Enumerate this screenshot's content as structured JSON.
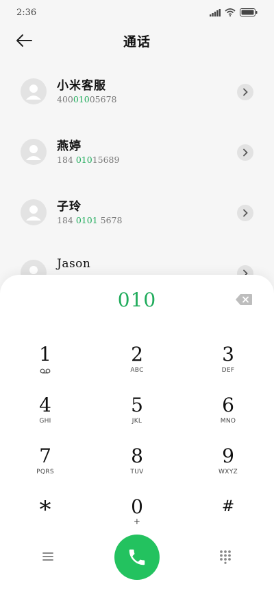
{
  "status_bar": {
    "time": "2:36"
  },
  "header": {
    "title": "通话"
  },
  "contacts": [
    {
      "name": "小米客服",
      "number_parts": [
        "400",
        "010",
        "05678"
      ]
    },
    {
      "name": "燕婷",
      "number_parts": [
        "184 ",
        "010",
        "15689"
      ]
    },
    {
      "name": "子玲",
      "number_parts": [
        "184 ",
        "0101",
        " 5678"
      ]
    },
    {
      "name": "Jason",
      "number_parts": [
        "",
        "",
        ""
      ]
    }
  ],
  "dialer": {
    "dialed": "010",
    "keys": [
      {
        "digit": "1",
        "letters": ""
      },
      {
        "digit": "2",
        "letters": "ABC"
      },
      {
        "digit": "3",
        "letters": "DEF"
      },
      {
        "digit": "4",
        "letters": "GHI"
      },
      {
        "digit": "5",
        "letters": "JKL"
      },
      {
        "digit": "6",
        "letters": "MNO"
      },
      {
        "digit": "7",
        "letters": "PQRS"
      },
      {
        "digit": "8",
        "letters": "TUV"
      },
      {
        "digit": "9",
        "letters": "WXYZ"
      },
      {
        "digit": "*",
        "letters": ""
      },
      {
        "digit": "0",
        "letters": "+"
      },
      {
        "digit": "#",
        "letters": ""
      }
    ]
  },
  "colors": {
    "accent": "#1fab5b",
    "call_button": "#23c25f",
    "avatar_bg": "#e3e3e3"
  },
  "icons": {
    "status": [
      "signal-icon",
      "wifi-icon",
      "battery-icon"
    ],
    "header": "back-arrow-icon",
    "row": "chevron-right-icon",
    "dialer": [
      "backspace-icon",
      "voicemail-icon",
      "menu-icon",
      "phone-icon",
      "keypad-icon"
    ]
  }
}
